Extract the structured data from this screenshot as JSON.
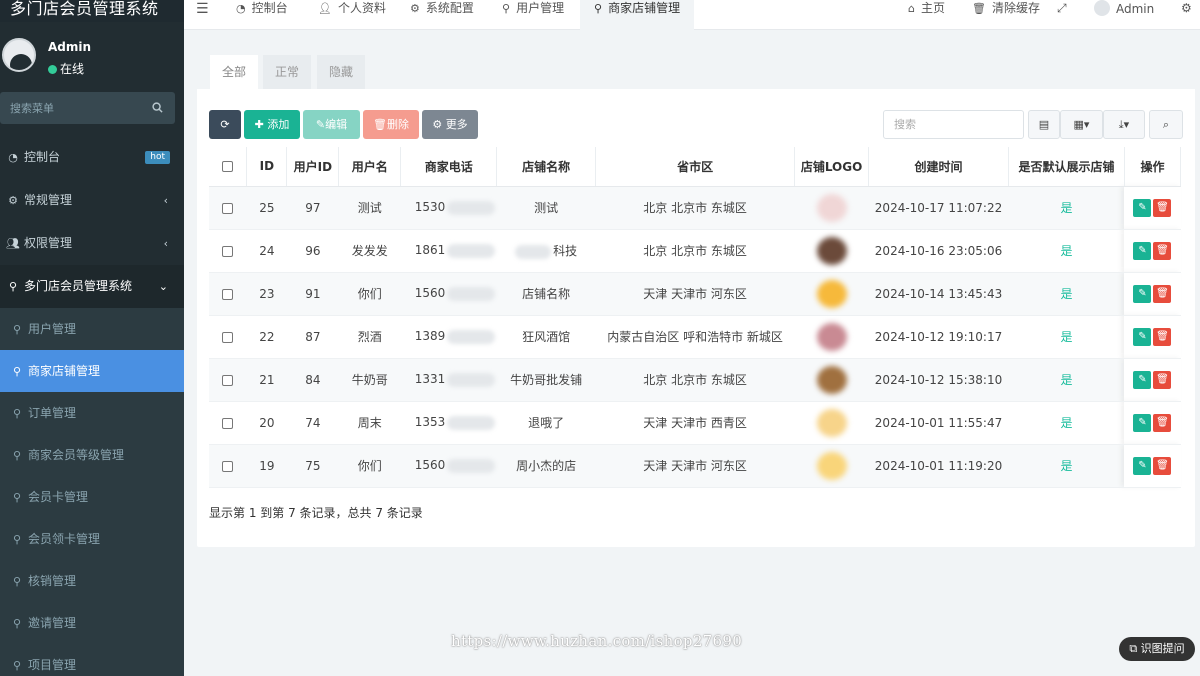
{
  "app": {
    "title": "多门店会员管理系统",
    "user": "Admin",
    "status": "在线"
  },
  "sidebar": {
    "search_placeholder": "搜索菜单",
    "hot_badge": "hot",
    "items": [
      {
        "label": "控制台",
        "icon": "dashboard-icon"
      },
      {
        "label": "常规管理",
        "icon": "cogs-icon"
      },
      {
        "label": "权限管理",
        "icon": "users-icon"
      },
      {
        "label": "多门店会员管理系统",
        "icon": "map-marker-icon"
      }
    ],
    "subitems": [
      {
        "label": "用户管理"
      },
      {
        "label": "商家店铺管理"
      },
      {
        "label": "订单管理"
      },
      {
        "label": "商家会员等级管理"
      },
      {
        "label": "会员卡管理"
      },
      {
        "label": "会员领卡管理"
      },
      {
        "label": "核销管理"
      },
      {
        "label": "邀请管理"
      },
      {
        "label": "项目管理"
      }
    ]
  },
  "topbar": {
    "tabs": [
      "控制台",
      "个人资料",
      "系统配置",
      "用户管理",
      "商家店铺管理"
    ],
    "home": "主页",
    "clear_cache": "清除缓存",
    "user": "Admin"
  },
  "content": {
    "tabs": [
      "全部",
      "正常",
      "隐藏"
    ],
    "buttons": {
      "add": "添加",
      "edit": "编辑",
      "delete": "删除",
      "more": "更多"
    },
    "search_placeholder": "搜索",
    "columns": [
      "ID",
      "用户ID",
      "用户名",
      "商家电话",
      "店铺名称",
      "省市区",
      "店铺LOGO",
      "创建时间",
      "是否默认展示店铺",
      "操作"
    ],
    "rows": [
      {
        "id": "25",
        "uid": "97",
        "name": "测试",
        "phone": "1530",
        "shop": "测试",
        "region": "北京 北京市 东城区",
        "created": "2024-10-17 11:07:22",
        "default": "是",
        "logo_color": "#f0d6d6"
      },
      {
        "id": "24",
        "uid": "96",
        "name": "发发发",
        "phone": "1861",
        "shop": "科技",
        "region": "北京 北京市 东城区",
        "created": "2024-10-16 23:05:06",
        "default": "是",
        "logo_color": "#6b4a3a"
      },
      {
        "id": "23",
        "uid": "91",
        "name": "你们",
        "phone": "1560",
        "shop": "店铺名称",
        "region": "天津 天津市 河东区",
        "created": "2024-10-14 13:45:43",
        "default": "是",
        "logo_color": "#f6b93b"
      },
      {
        "id": "22",
        "uid": "87",
        "name": "烈酒",
        "phone": "1389",
        "shop": "狂风酒馆",
        "region": "内蒙古自治区 呼和浩特市 新城区",
        "created": "2024-10-12 19:10:17",
        "default": "是",
        "logo_color": "#c98a93"
      },
      {
        "id": "21",
        "uid": "84",
        "name": "牛奶哥",
        "phone": "1331",
        "shop": "牛奶哥批发铺",
        "region": "北京 北京市 东城区",
        "created": "2024-10-12 15:38:10",
        "default": "是",
        "logo_color": "#a0703f"
      },
      {
        "id": "20",
        "uid": "74",
        "name": "周末",
        "phone": "1353",
        "shop": "退哦了",
        "region": "天津 天津市 西青区",
        "created": "2024-10-01 11:55:47",
        "default": "是",
        "logo_color": "#f7d48a"
      },
      {
        "id": "19",
        "uid": "75",
        "name": "你们",
        "phone": "1560",
        "shop": "周小杰的店",
        "region": "天津 天津市 河东区",
        "created": "2024-10-01 11:19:20",
        "default": "是",
        "logo_color": "#f9d57a"
      }
    ],
    "summary": "显示第 1 到第 7 条记录，总共 7 条记录"
  },
  "watermark": "https://www.huzhan.com/ishop27690",
  "ocr_button": "识图提问"
}
